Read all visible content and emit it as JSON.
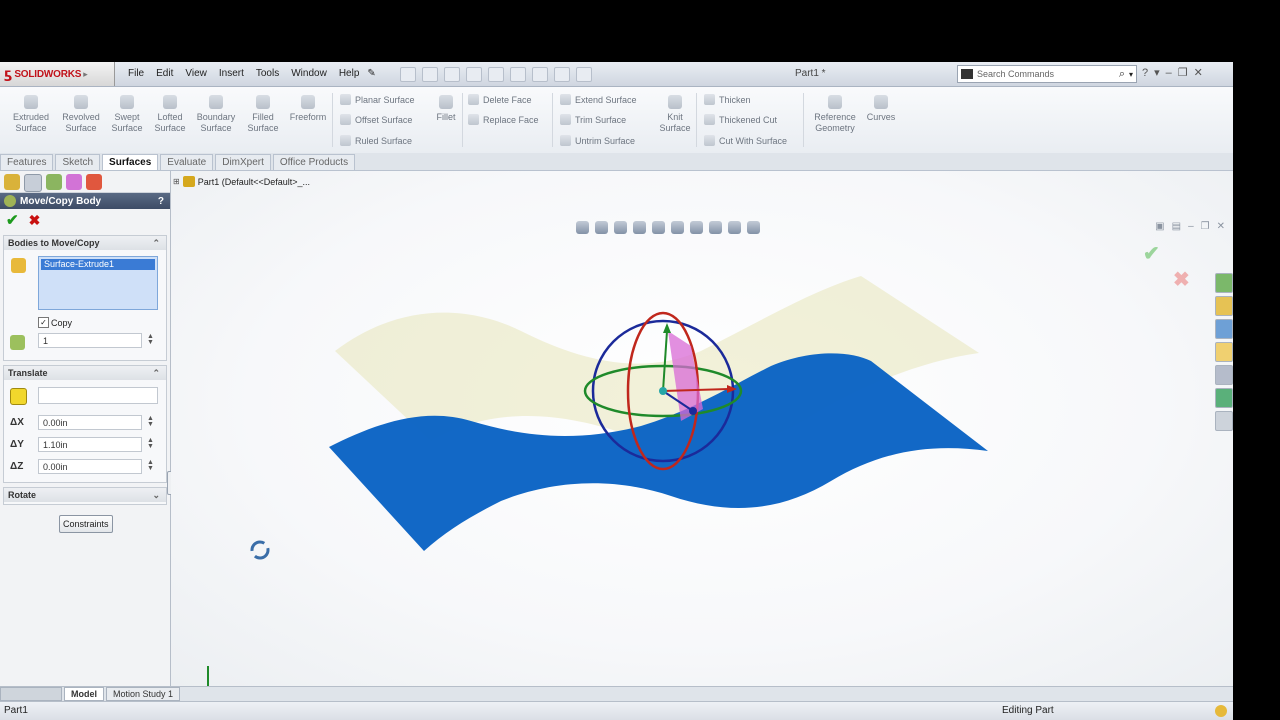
{
  "app": {
    "logo_ds": "ƽ",
    "logo_text": "SOLIDWORKS",
    "document_title": "Part1 *",
    "menus": [
      "File",
      "Edit",
      "View",
      "Insert",
      "Tools",
      "Window",
      "Help"
    ],
    "search_placeholder": "Search Commands"
  },
  "ribbon": {
    "big_buttons": [
      "Extruded\nSurface",
      "Revolved\nSurface",
      "Swept\nSurface",
      "Lofted\nSurface",
      "Boundary\nSurface",
      "Filled\nSurface",
      "Freeform"
    ],
    "col1": [
      "Planar Surface",
      "Offset Surface",
      "Ruled Surface"
    ],
    "fillet": "Fillet",
    "col2": [
      "Delete Face",
      "Replace Face"
    ],
    "col3": [
      "Extend Surface",
      "Trim Surface",
      "Untrim Surface"
    ],
    "knit": "Knit\nSurface",
    "col4": [
      "Thicken",
      "Thickened Cut",
      "Cut With Surface"
    ],
    "reference_geometry": "Reference\nGeometry",
    "curves": "Curves"
  },
  "tabs": [
    {
      "label": "Features",
      "active": false
    },
    {
      "label": "Sketch",
      "active": false
    },
    {
      "label": "Surfaces",
      "active": true
    },
    {
      "label": "Evaluate",
      "active": false
    },
    {
      "label": "DimXpert",
      "active": false
    },
    {
      "label": "Office Products",
      "active": false
    }
  ],
  "property_manager": {
    "title": "Move/Copy Body",
    "help": "?",
    "ok": "✔",
    "cancel": "✖",
    "bodies_group": "Bodies to Move/Copy",
    "selected_body": "Surface-Extrude1",
    "copy_label": "Copy",
    "copy_checked": true,
    "copies": "1",
    "translate_group": "Translate",
    "dx_label": "ΔX",
    "dx": "0.00in",
    "dy_label": "ΔY",
    "dy": "1.10in",
    "dz_label": "ΔZ",
    "dz": "0.00in",
    "rotate_group": "Rotate",
    "constraints_button": "Constraints"
  },
  "viewport": {
    "tree_label": "Part1  (Default<<Default>_..."
  },
  "bottom_tabs": [
    {
      "label": "",
      "active": false
    },
    {
      "label": "Model",
      "active": true
    },
    {
      "label": "Motion Study 1",
      "active": false
    }
  ],
  "status": {
    "left": "Part1",
    "right": "Editing Part"
  },
  "colors": {
    "surface_original": "#0a63c4",
    "surface_copy": "#e7e6ba",
    "triad_x": "#c0271c",
    "triad_y": "#1f8a2a",
    "triad_z": "#1b2a9a"
  }
}
